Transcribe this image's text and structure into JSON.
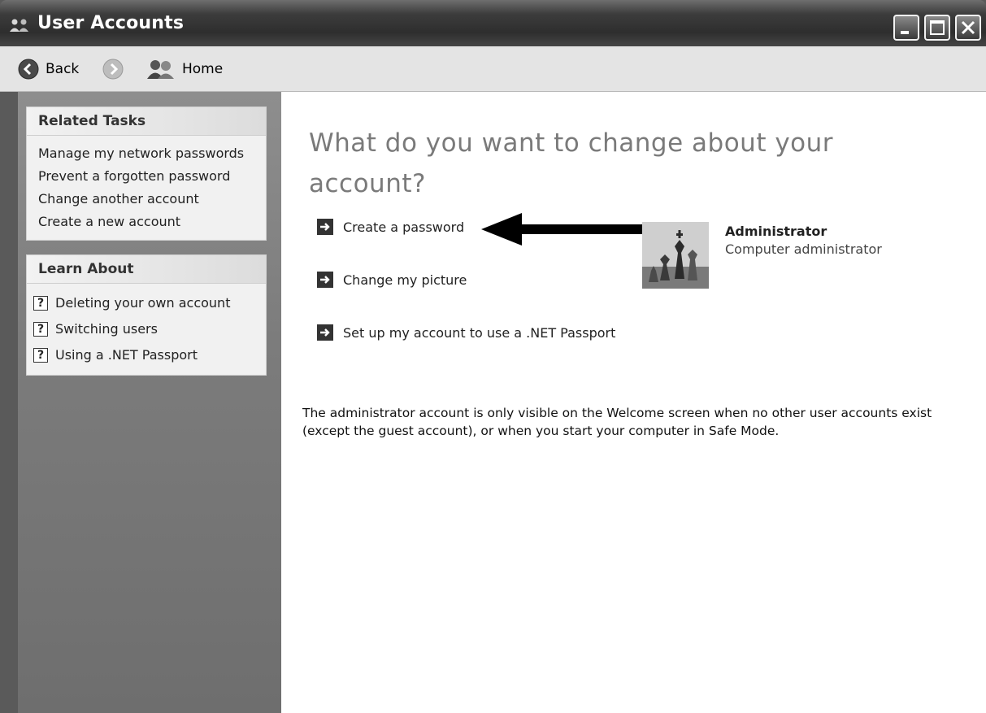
{
  "window": {
    "title": "User Accounts",
    "controls": {
      "minimize": "minimize-icon",
      "maximize": "maximize-icon",
      "close": "close-icon"
    }
  },
  "toolbar": {
    "back_label": "Back",
    "home_label": "Home"
  },
  "sidebar": {
    "related_tasks": {
      "title": "Related Tasks",
      "items": [
        {
          "label": "Manage my network passwords"
        },
        {
          "label": "Prevent a forgotten password"
        },
        {
          "label": "Change another account"
        },
        {
          "label": "Create a new account"
        }
      ]
    },
    "learn_about": {
      "title": "Learn About",
      "items": [
        {
          "label": "Deleting your own account"
        },
        {
          "label": "Switching users"
        },
        {
          "label": "Using a .NET Passport"
        }
      ]
    }
  },
  "main": {
    "heading": "What do you want to change about your account?",
    "actions": [
      {
        "label": "Create a password"
      },
      {
        "label": "Change my picture"
      },
      {
        "label": "Set up my account to use a .NET Passport"
      }
    ],
    "user": {
      "name": "Administrator",
      "role": "Computer administrator"
    },
    "info": "The administrator account is only visible on the Welcome screen when no other user accounts exist (except the guest account), or when you start your computer in Safe Mode."
  }
}
